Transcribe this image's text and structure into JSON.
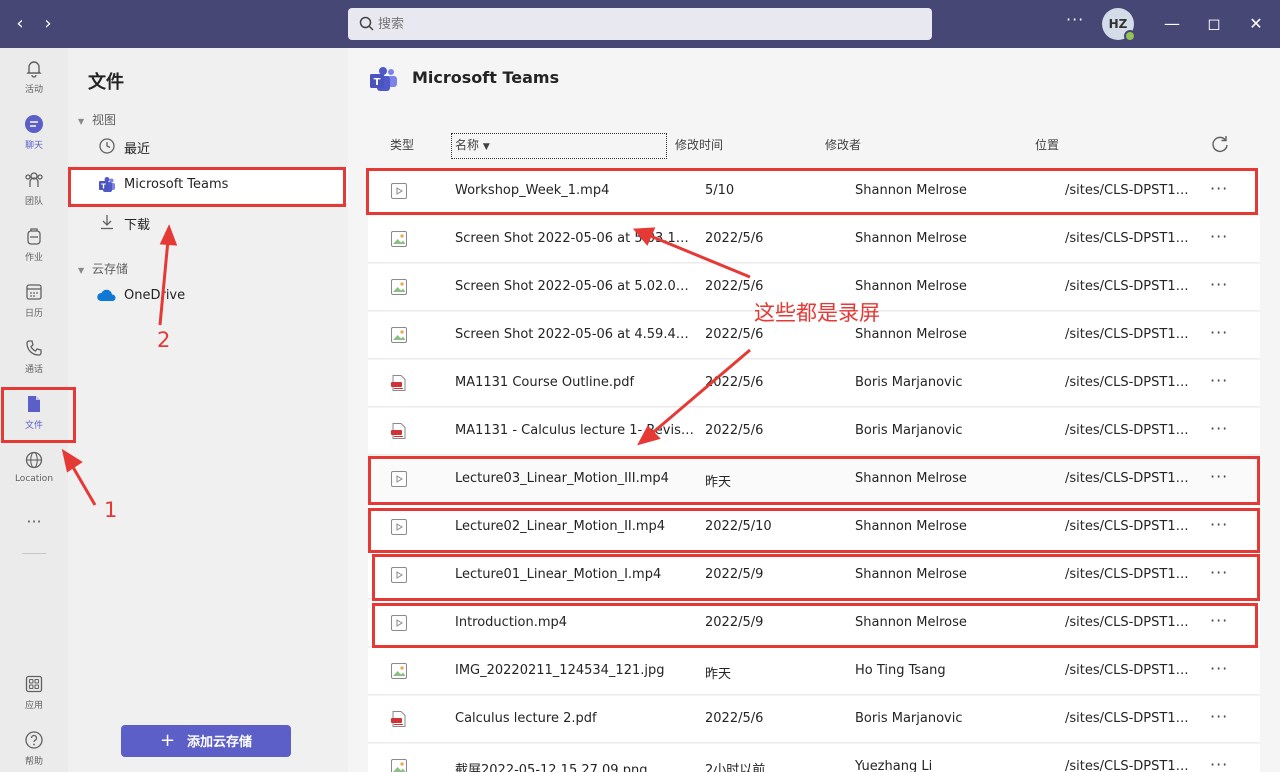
{
  "titlebar": {
    "search_placeholder": "搜索",
    "more": "···",
    "avatar_initials": "HZ"
  },
  "rail": {
    "items": [
      {
        "label": "活动",
        "icon": "bell-icon"
      },
      {
        "label": "聊天",
        "icon": "chat-icon"
      },
      {
        "label": "团队",
        "icon": "teams-icon"
      },
      {
        "label": "作业",
        "icon": "backpack-icon"
      },
      {
        "label": "日历",
        "icon": "calendar-icon"
      },
      {
        "label": "通话",
        "icon": "phone-icon"
      },
      {
        "label": "文件",
        "icon": "file-icon"
      },
      {
        "label": "Location",
        "icon": "globe-icon"
      }
    ],
    "more": "···",
    "apps_label": "应用",
    "help_label": "帮助"
  },
  "panel": {
    "title": "文件",
    "views_header": "视图",
    "recent": "最近",
    "microsoft_teams": "Microsoft Teams",
    "downloads": "下载",
    "cloud_header": "云存储",
    "onedrive": "OneDrive",
    "add_cloud": "添加云存储"
  },
  "main": {
    "title": "Microsoft Teams",
    "columns": {
      "type": "类型",
      "name": "名称",
      "modified": "修改时间",
      "modified_by": "修改者",
      "location": "位置"
    },
    "files": [
      {
        "type": "video",
        "name": "Workshop_Week_1.mp4",
        "date": "5/10",
        "by": "Shannon Melrose",
        "loc": "/sites/CLS-DPST10..."
      },
      {
        "type": "image",
        "name": "Screen Shot 2022-05-06 at 5.03.17 p...",
        "date": "2022/5/6",
        "by": "Shannon Melrose",
        "loc": "/sites/CLS-DPST10..."
      },
      {
        "type": "image",
        "name": "Screen Shot 2022-05-06 at 5.02.01 p...",
        "date": "2022/5/6",
        "by": "Shannon Melrose",
        "loc": "/sites/CLS-DPST10..."
      },
      {
        "type": "image",
        "name": "Screen Shot 2022-05-06 at 4.59.44 p...",
        "date": "2022/5/6",
        "by": "Shannon Melrose",
        "loc": "/sites/CLS-DPST10..."
      },
      {
        "type": "pdf",
        "name": "MA1131 Course Outline.pdf",
        "date": "2022/5/6",
        "by": "Boris Marjanovic",
        "loc": "/sites/CLS-DPST10..."
      },
      {
        "type": "pdf",
        "name": "MA1131 - Calculus lecture 1- Revisio...",
        "date": "2022/5/6",
        "by": "Boris Marjanovic",
        "loc": "/sites/CLS-DPST10..."
      },
      {
        "type": "video",
        "name": "Lecture03_Linear_Motion_III.mp4",
        "date": "昨天",
        "by": "Shannon Melrose",
        "loc": "/sites/CLS-DPST10..."
      },
      {
        "type": "video",
        "name": "Lecture02_Linear_Motion_II.mp4",
        "date": "2022/5/10",
        "by": "Shannon Melrose",
        "loc": "/sites/CLS-DPST10..."
      },
      {
        "type": "video",
        "name": "Lecture01_Linear_Motion_I.mp4",
        "date": "2022/5/9",
        "by": "Shannon Melrose",
        "loc": "/sites/CLS-DPST10..."
      },
      {
        "type": "video",
        "name": "Introduction.mp4",
        "date": "2022/5/9",
        "by": "Shannon Melrose",
        "loc": "/sites/CLS-DPST10..."
      },
      {
        "type": "image",
        "name": "IMG_20220211_124534_121.jpg",
        "date": "昨天",
        "by": "Ho Ting Tsang",
        "loc": "/sites/CLS-DPST10..."
      },
      {
        "type": "pdf",
        "name": "Calculus lecture 2.pdf",
        "date": "2022/5/6",
        "by": "Boris Marjanovic",
        "loc": "/sites/CLS-DPST10..."
      },
      {
        "type": "image",
        "name": "截屏2022-05-12 15.27.09.png",
        "date": "2小时以前",
        "by": "Yuezhang Li",
        "loc": "/sites/CLS-DPST10..."
      }
    ],
    "row_more": "···"
  },
  "annotations": {
    "label_1": "1",
    "label_2": "2",
    "callout": "这些都是录屏",
    "color": "#e53935"
  }
}
